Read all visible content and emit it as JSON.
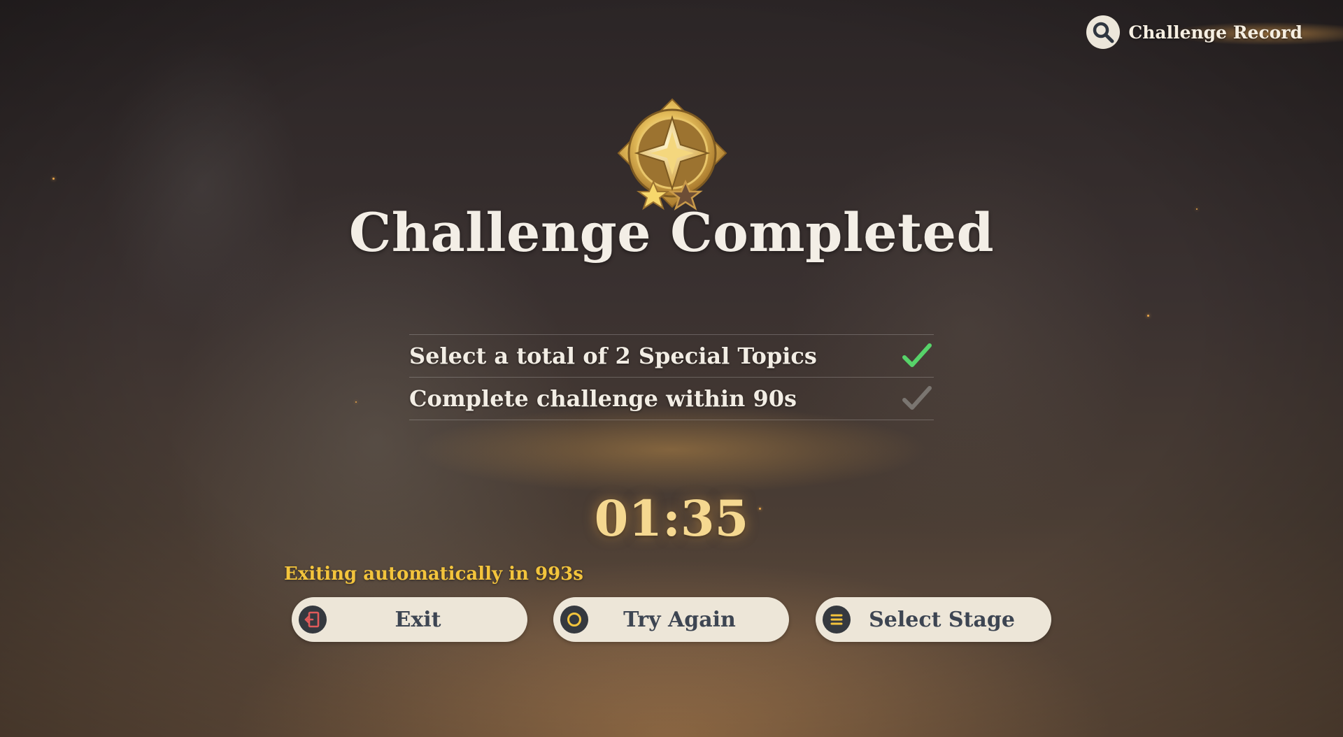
{
  "header": {
    "record_label": "Challenge Record",
    "record_icon": "search-icon"
  },
  "result": {
    "title": "Challenge Completed",
    "stars_earned": 1,
    "stars_total": 2,
    "medal_icon": "gold-star-medal-icon"
  },
  "objectives": [
    {
      "text": "Select a total of 2 Special Topics",
      "completed": true,
      "check_color": "#57d36a"
    },
    {
      "text": "Complete challenge within 90s",
      "completed": false,
      "check_color": "#7a7570"
    }
  ],
  "timer": {
    "value": "01:35"
  },
  "auto_exit": {
    "text": "Exiting automatically in 993s"
  },
  "buttons": {
    "exit": {
      "label": "Exit",
      "icon": "exit-door-icon",
      "icon_color": "#e05a5a"
    },
    "try_again": {
      "label": "Try Again",
      "icon": "circle-icon",
      "icon_color": "#f3c43c"
    },
    "select_stage": {
      "label": "Select Stage",
      "icon": "menu-lines-icon",
      "icon_color": "#f3c43c"
    }
  },
  "colors": {
    "accent_gold": "#f3c43c",
    "timer_gold": "#f5d890",
    "button_bg": "#ede6d8",
    "button_text": "#3d4552"
  }
}
